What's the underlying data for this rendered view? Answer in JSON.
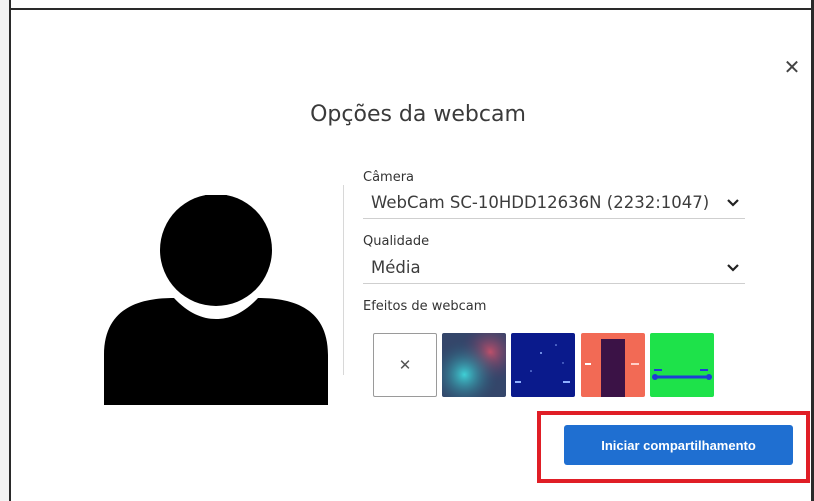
{
  "dialog": {
    "title": "Opções da webcam",
    "close_icon": "close-icon",
    "close_glyph": "✕"
  },
  "camera": {
    "label": "Câmera",
    "value": "WebCam SC-10HDD12636N (2232:1047)"
  },
  "quality": {
    "label": "Qualidade",
    "value": "Média"
  },
  "effects": {
    "label": "Efeitos de webcam",
    "none_glyph": "✕",
    "items": [
      {
        "name": "none"
      },
      {
        "name": "blur-background"
      },
      {
        "name": "dark-blue-background"
      },
      {
        "name": "orange-purple-background"
      },
      {
        "name": "green-background"
      }
    ]
  },
  "actions": {
    "start_sharing": "Iniciar compartilhamento"
  },
  "colors": {
    "primary": "#1f6fd1",
    "highlight": "#e01e26",
    "text": "#3a3a3a"
  }
}
